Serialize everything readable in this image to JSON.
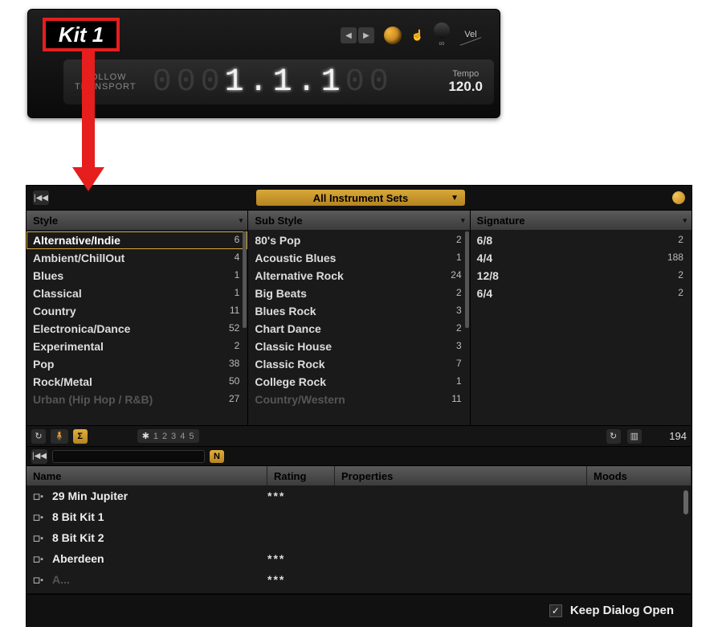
{
  "transport": {
    "kit_name": "Kit 1",
    "follow_line1": "FOLLOW",
    "follow_line2": "TRANSPORT",
    "position_dim_prefix": "000",
    "position_value": "1.1.1",
    "position_dim_suffix": "00",
    "tempo_label": "Tempo",
    "tempo_value": "120.0",
    "vel_label": "Vel",
    "loop_symbol": "∞"
  },
  "browser": {
    "instrument_sets_label": "All Instrument Sets",
    "columns": {
      "style": {
        "header": "Style",
        "items": [
          {
            "label": "Alternative/Indie",
            "count": 6,
            "selected": true
          },
          {
            "label": "Ambient/ChillOut",
            "count": 4
          },
          {
            "label": "Blues",
            "count": 1
          },
          {
            "label": "Classical",
            "count": 1
          },
          {
            "label": "Country",
            "count": 11
          },
          {
            "label": "Electronica/Dance",
            "count": 52
          },
          {
            "label": "Experimental",
            "count": 2
          },
          {
            "label": "Pop",
            "count": 38
          },
          {
            "label": "Rock/Metal",
            "count": 50
          },
          {
            "label": "Urban (Hip Hop / R&B)",
            "count": 27,
            "clipped": true
          }
        ]
      },
      "substyle": {
        "header": "Sub Style",
        "items": [
          {
            "label": "80's Pop",
            "count": 2
          },
          {
            "label": "Acoustic Blues",
            "count": 1
          },
          {
            "label": "Alternative Rock",
            "count": 24
          },
          {
            "label": "Big Beats",
            "count": 2
          },
          {
            "label": "Blues Rock",
            "count": 3
          },
          {
            "label": "Chart Dance",
            "count": 2
          },
          {
            "label": "Classic House",
            "count": 3
          },
          {
            "label": "Classic Rock",
            "count": 7
          },
          {
            "label": "College Rock",
            "count": 1
          },
          {
            "label": "Country/Western",
            "count": 11,
            "clipped": true
          }
        ]
      },
      "signature": {
        "header": "Signature",
        "items": [
          {
            "label": "6/8",
            "count": 2
          },
          {
            "label": "4/4",
            "count": 188
          },
          {
            "label": "12/8",
            "count": 2
          },
          {
            "label": "6/4",
            "count": 2
          }
        ]
      }
    },
    "pager": {
      "pages": [
        "1",
        "2",
        "3",
        "4",
        "5"
      ]
    },
    "result_count": "194",
    "n_button": "N",
    "sigma": "Σ",
    "results_headers": {
      "name": "Name",
      "rating": "Rating",
      "properties": "Properties",
      "moods": "Moods"
    },
    "results": [
      {
        "name": "29 Min Jupiter",
        "rating": "***"
      },
      {
        "name": "8 Bit Kit 1",
        "rating": ""
      },
      {
        "name": "8 Bit Kit 2",
        "rating": ""
      },
      {
        "name": "Aberdeen",
        "rating": "***"
      },
      {
        "name": "A...",
        "rating": "***",
        "clipped": true
      }
    ],
    "keep_dialog_label": "Keep Dialog Open",
    "keep_dialog_checked": true
  }
}
